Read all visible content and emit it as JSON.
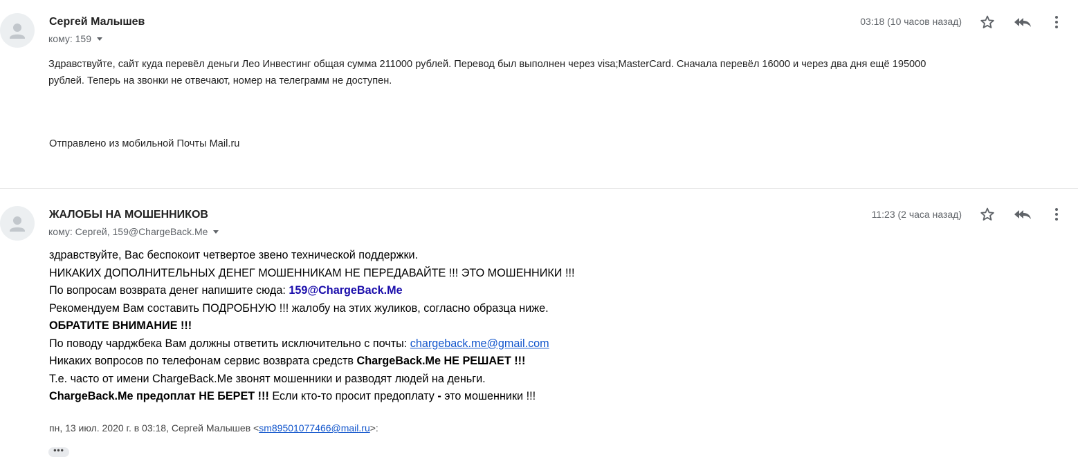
{
  "messages": [
    {
      "sender": "Сергей Малышев",
      "recipients": "кому: 159",
      "timestamp": "03:18 (10 часов назад)",
      "body_lines": [
        "Здравствуйте, сайт куда перевёл деньги Лео Инвестинг общая сумма 211000 рублей. Перевод был выполнен через visa;MasterCard. Сначала перевёл 16000 и через два дня ещё 195000",
        "рублей.  Теперь на звонки не отвечают, номер на телеграмм не доступен."
      ],
      "signature": "Отправлено из мобильной Почты Mail.ru"
    },
    {
      "sender": "ЖАЛОБЫ НА МОШЕННИКОВ",
      "recipients": "кому: Сергей, 159@ChargeBack.Me",
      "timestamp": "11:23 (2 часа назад)",
      "body": {
        "l1": "здравствуйте, Вас беспокоит четвертое звено технической поддержки.",
        "l2": "НИКАКИХ ДОПОЛНИТЕЛЬНЫХ ДЕНЕГ МОШЕННИКАМ НЕ ПЕРЕДАВАЙТЕ !!! ЭТО МОШЕННИКИ !!!",
        "l3_prefix": "По вопросам возврата денег напишите сюда: ",
        "l3_email": "159@ChargeBack.Me",
        "l4": "Рекомендуем Вам составить ПОДРОБНУЮ !!! жалобу на этих жуликов, согласно образца ниже.",
        "l5": "ОБРАТИТЕ ВНИМАНИЕ !!!",
        "l6_prefix": "По поводу чарджбека Вам должны ответить исключительно с почты: ",
        "l6_link": "chargeback.me@gmail.com",
        "l7_prefix": "Никаких вопросов по телефонам сервис возврата средств ",
        "l7_bold": "ChargeBack.Me НЕ РЕШАЕТ !!!",
        "l8": "Т.е. часто от имени ChargeBack.Me звонят мошенники и разводят людей на деньги.",
        "l9_bold": "ChargeBack.Me предоплат НЕ БЕРЕТ !!!",
        "l9_mid": " Если кто-то просит предоплату ",
        "l9_dash": "-",
        "l9_suffix": " это мошенники !!!"
      },
      "quote_header_prefix": "пн, 13 июл. 2020 г. в 03:18, Сергей Малышев <",
      "quote_header_email": "sm89501077466@mail.ru",
      "quote_header_suffix": ">:",
      "ellipsis": "•••"
    }
  ],
  "icons": [
    "avatar-icon",
    "star-icon",
    "reply-all-icon",
    "more-vert-icon",
    "dropdown-caret-icon"
  ]
}
